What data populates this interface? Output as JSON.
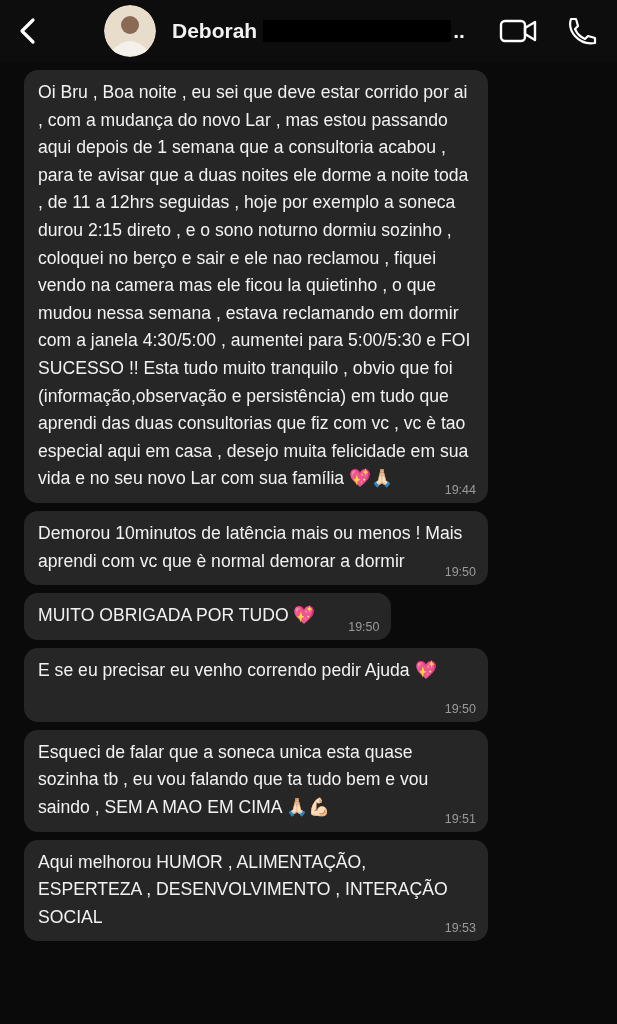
{
  "header": {
    "contact_name": "Deborah",
    "name_end": "..",
    "name_redacted": true
  },
  "messages": [
    {
      "text": "Oi Bru , Boa noite , eu sei que deve estar corrido por ai , com a mudança do novo Lar , mas estou passando aqui depois de 1 semana que a consultoria acabou , para te avisar que a duas noites ele dorme a noite toda , de 11 a 12hrs seguidas , hoje por exemplo a soneca durou 2:15 direto , e o sono noturno dormiu sozinho , coloquei no berço e sair e ele nao reclamou , fiquei vendo na camera mas ele ficou la quietinho , o que mudou nessa semana , estava reclamando em dormir com a janela 4:30/5:00 , aumentei para 5:00/5:30 e FOI SUCESSO !! Esta tudo muito tranquilo , obvio que foi (informação,observação e persistência) em tudo que aprendi das duas consultorias que fiz com vc , vc è tao especial aqui em casa , desejo muita felicidade em sua vida e no seu novo Lar com sua família 💖🙏🏻",
      "time": "19:44"
    },
    {
      "text": "Demorou 10minutos de latência mais ou menos ! Mais aprendi com vc que è normal demorar a dormir",
      "time": "19:50"
    },
    {
      "text": "MUITO OBRIGADA POR TUDO 💖",
      "time": "19:50"
    },
    {
      "text": "E se eu precisar eu venho correndo pedir Ajuda 💖",
      "time": "19:50"
    },
    {
      "text": "Esqueci de falar que a soneca unica esta quase sozinha tb , eu vou falando que ta tudo bem e vou saindo , SEM A MAO EM CIMA 🙏🏻💪🏻",
      "time": "19:51"
    },
    {
      "text": "Aqui melhorou HUMOR , ALIMENTAÇÃO, ESPERTEZA , DESENVOLVIMENTO , INTERAÇÃO SOCIAL",
      "time": "19:53"
    }
  ]
}
